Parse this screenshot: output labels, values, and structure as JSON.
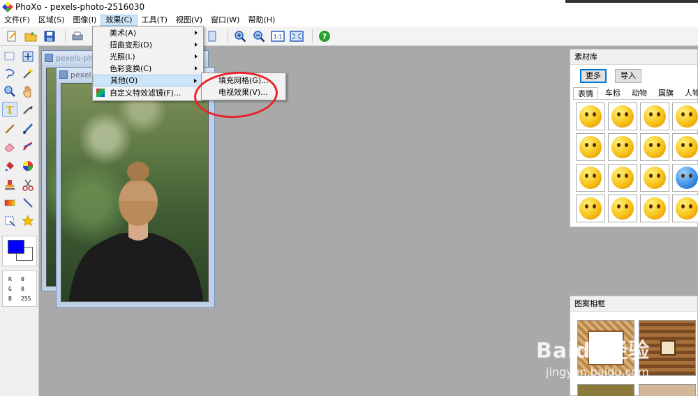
{
  "window": {
    "title": "PhoXo - pexels-photo-2516030"
  },
  "menubar": {
    "items": [
      {
        "label": "文件(F)"
      },
      {
        "label": "区域(S)"
      },
      {
        "label": "图像(I)"
      },
      {
        "label": "效果(C)"
      },
      {
        "label": "工具(T)"
      },
      {
        "label": "视图(V)"
      },
      {
        "label": "窗口(W)"
      },
      {
        "label": "帮助(H)"
      }
    ]
  },
  "effects_menu": {
    "items": [
      {
        "label": "美术(A)"
      },
      {
        "label": "扭曲变形(D)"
      },
      {
        "label": "光照(L)"
      },
      {
        "label": "色彩变换(C)"
      },
      {
        "label": "其他(O)"
      },
      {
        "label": "自定义特效滤镜(F)..."
      }
    ]
  },
  "other_submenu": {
    "items": [
      {
        "label": "填充网格(G)..."
      },
      {
        "label": "电视效果(V)..."
      }
    ]
  },
  "documents": {
    "back_title": "pexels-ph",
    "front_title": "pexel"
  },
  "color_panel": {
    "fg": "#0000ff",
    "bg": "#ffffff",
    "r_label": "R",
    "r_value": "0",
    "g_label": "G",
    "g_value": "0",
    "b_label": "B",
    "b_value": "255"
  },
  "materials_panel": {
    "title": "素材库",
    "more_button": "更多",
    "import_button": "导入",
    "tabs": [
      {
        "label": "表情"
      },
      {
        "label": "车标"
      },
      {
        "label": "动物"
      },
      {
        "label": "国旗"
      },
      {
        "label": "人物"
      }
    ]
  },
  "frames_panel": {
    "title": "图案相框"
  },
  "watermark": {
    "main": "Baidu经验",
    "sub": "jingyan.baidu.com"
  },
  "colors": {
    "annotation": "#e8232b",
    "accent": "#0078d7"
  }
}
